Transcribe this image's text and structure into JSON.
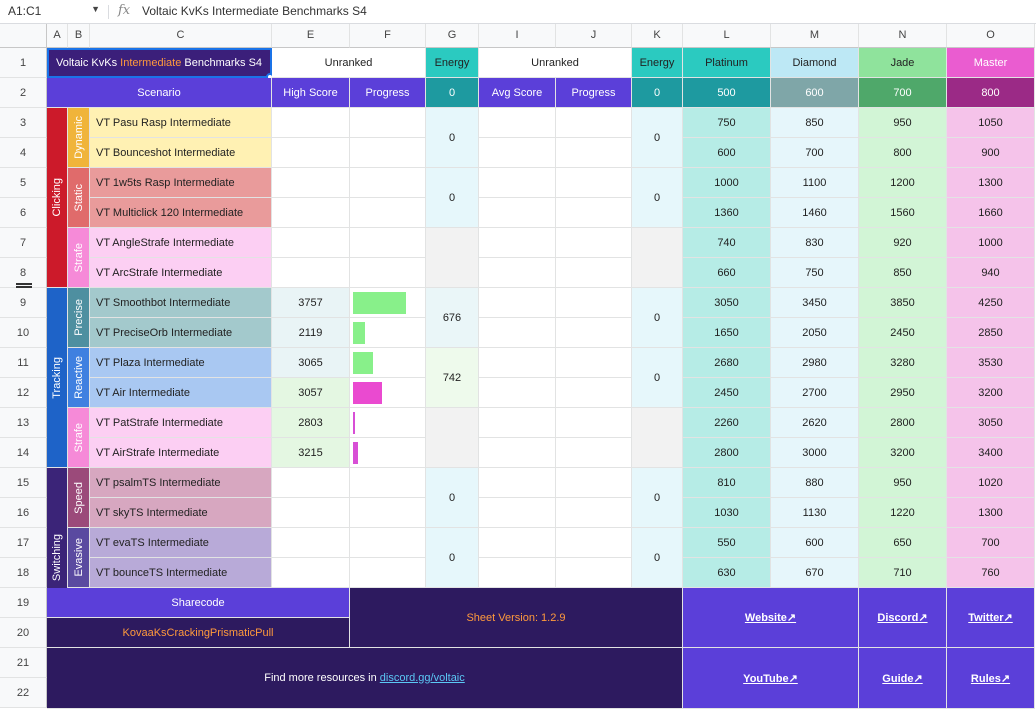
{
  "formula_bar": {
    "name_box": "A1:C1",
    "dropdown_icon": "caret-down",
    "fx": "fx",
    "formula": "Voltaic KvKs Intermediate Benchmarks S4"
  },
  "columns": [
    "A",
    "B",
    "C",
    "E",
    "F",
    "G",
    "I",
    "J",
    "K",
    "L",
    "M",
    "N",
    "O"
  ],
  "rows": [
    "1",
    "2",
    "3",
    "4",
    "5",
    "6",
    "7",
    "8",
    "9",
    "10",
    "11",
    "12",
    "13",
    "14",
    "15",
    "16",
    "17",
    "18",
    "19",
    "20",
    "21",
    "22"
  ],
  "title": {
    "pre": "Voltaic KvKs ",
    "accent": "Intermediate",
    "post": " Benchmarks S4"
  },
  "header1": {
    "unranked_a": "Unranked",
    "energy_a": "Energy",
    "unranked_b": "Unranked",
    "energy_b": "Energy",
    "platinum": "Platinum",
    "diamond": "Diamond",
    "jade": "Jade",
    "master": "Master"
  },
  "header2": {
    "scenario": "Scenario",
    "high_score": "High Score",
    "progress_a": "Progress",
    "energy_a": "0",
    "avg_score": "Avg Score",
    "progress_b": "Progress",
    "energy_b": "0",
    "platinum": "500",
    "diamond": "600",
    "jade": "700",
    "master": "800"
  },
  "categories": [
    "Clicking",
    "Tracking",
    "Switching"
  ],
  "subcategories": [
    "Dynamic",
    "Static",
    "Strafe",
    "Precise",
    "Reactive",
    "Strafe",
    "Speed",
    "Evasive"
  ],
  "scenarios": [
    {
      "name": "VT Pasu Rasp Intermediate",
      "high": "",
      "progress": 0,
      "ranks": [
        "750",
        "850",
        "950",
        "1050"
      ]
    },
    {
      "name": "VT Bounceshot Intermediate",
      "high": "",
      "progress": 0,
      "ranks": [
        "600",
        "700",
        "800",
        "900"
      ]
    },
    {
      "name": "VT 1w5ts Rasp Intermediate",
      "high": "",
      "progress": 0,
      "ranks": [
        "1000",
        "1100",
        "1200",
        "1300"
      ]
    },
    {
      "name": "VT Multiclick 120 Intermediate",
      "high": "",
      "progress": 0,
      "ranks": [
        "1360",
        "1460",
        "1560",
        "1660"
      ]
    },
    {
      "name": "VT AngleStrafe Intermediate",
      "high": "",
      "progress": 0,
      "ranks": [
        "740",
        "830",
        "920",
        "1000"
      ]
    },
    {
      "name": "VT ArcStrafe Intermediate",
      "high": "",
      "progress": 0,
      "ranks": [
        "660",
        "750",
        "850",
        "940"
      ]
    },
    {
      "name": "VT Smoothbot Intermediate",
      "high": "3757",
      "progress": 0.76,
      "ranks": [
        "3050",
        "3450",
        "3850",
        "4250"
      ]
    },
    {
      "name": "VT PreciseOrb Intermediate",
      "high": "2119",
      "progress": 0.17,
      "ranks": [
        "1650",
        "2050",
        "2450",
        "2850"
      ]
    },
    {
      "name": "VT Plaza Intermediate",
      "high": "3065",
      "progress": 0.28,
      "ranks": [
        "2680",
        "2980",
        "3280",
        "3530"
      ]
    },
    {
      "name": "VT Air Intermediate",
      "high": "3057",
      "progress": 0.42,
      "ranks": [
        "2450",
        "2700",
        "2950",
        "3200"
      ]
    },
    {
      "name": "VT PatStrafe Intermediate",
      "high": "2803",
      "progress": 0.03,
      "ranks": [
        "2260",
        "2620",
        "2800",
        "3050"
      ]
    },
    {
      "name": "VT AirStrafe Intermediate",
      "high": "3215",
      "progress": 0.07,
      "ranks": [
        "2800",
        "3000",
        "3200",
        "3400"
      ]
    },
    {
      "name": "VT psalmTS Intermediate",
      "high": "",
      "progress": 0,
      "ranks": [
        "810",
        "880",
        "950",
        "1020"
      ]
    },
    {
      "name": "VT skyTS Intermediate",
      "high": "",
      "progress": 0,
      "ranks": [
        "1030",
        "1130",
        "1220",
        "1300"
      ]
    },
    {
      "name": "VT evaTS Intermediate",
      "high": "",
      "progress": 0,
      "ranks": [
        "550",
        "600",
        "650",
        "700"
      ]
    },
    {
      "name": "VT bounceTS Intermediate",
      "high": "",
      "progress": 0,
      "ranks": [
        "630",
        "670",
        "710",
        "760"
      ]
    }
  ],
  "energy_g": [
    "0",
    "0",
    "",
    "676",
    "742",
    "",
    "0",
    "0"
  ],
  "energy_k": [
    "0",
    "0",
    "",
    "0",
    "0",
    "",
    "0",
    "0"
  ],
  "footer": {
    "sharecode_label": "Sharecode",
    "sharecode": "KovaaKsCrackingPrismaticPull",
    "version": "Sheet Version: 1.2.9",
    "resources_text": "Find more resources in ",
    "resources_link": "discord.gg/voltaic",
    "website": "Website↗",
    "discord": "Discord↗",
    "twitter": "Twitter↗",
    "youtube": "YouTube↗",
    "guide": "Guide↗",
    "rules": "Rules↗"
  },
  "colors": {
    "purple": "#5b3fd9",
    "teal": "#2bcac0",
    "platinum": "#2bcac0",
    "diamond": "#bde8f5",
    "jade": "#8fe39c",
    "master": "#ea5cd0",
    "dark": "#2d1a5f"
  }
}
